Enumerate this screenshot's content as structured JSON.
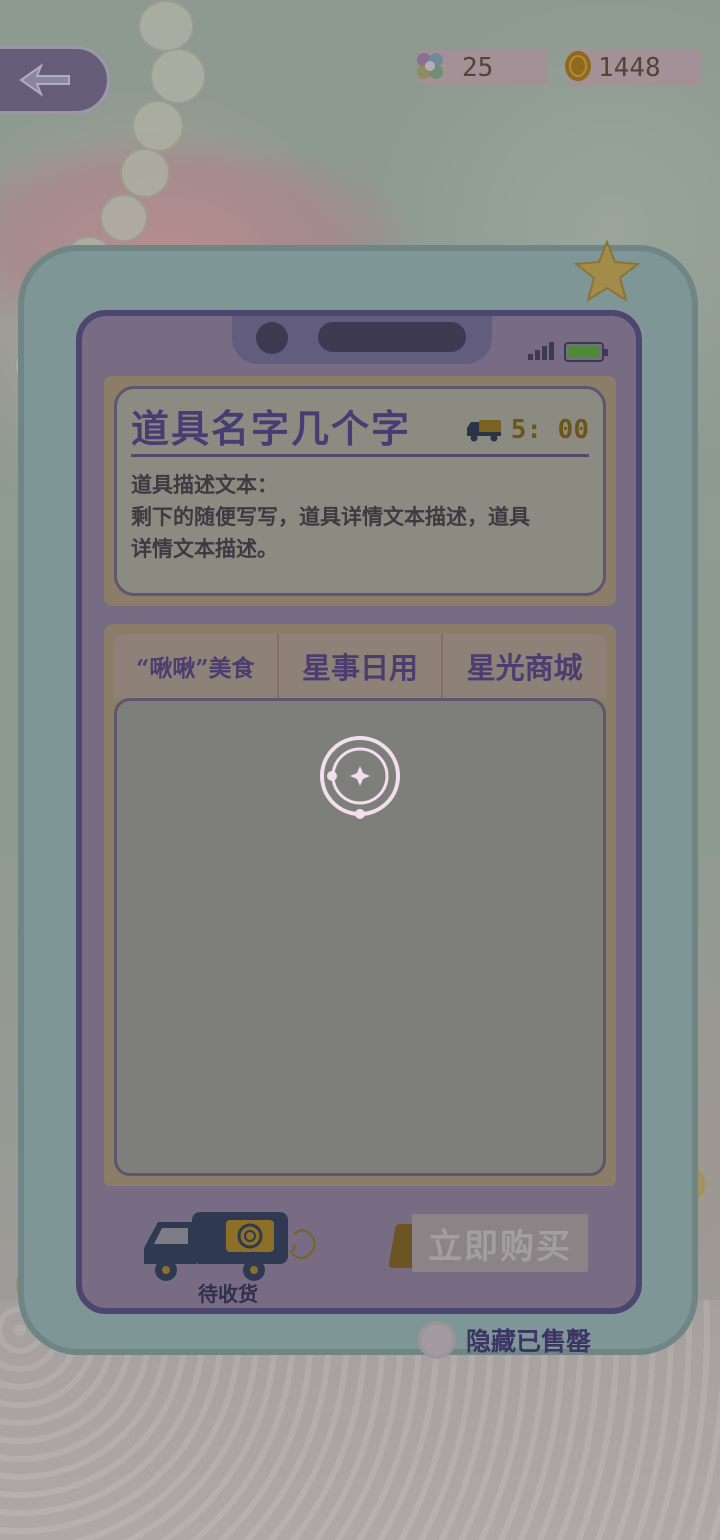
{
  "status": {
    "gems": "25",
    "coins": "1448",
    "gem_icon": "gem-flower-icon",
    "coin_icon": "coin-icon"
  },
  "back_icon": "back-arrow-icon",
  "item": {
    "title": "道具名字几个字",
    "delivery_time": "5: 00",
    "description_line1": "道具描述文本：",
    "description_line2": "剩下的随便写写，道具详情文本描述，道具",
    "description_line3": "详情文本描述。"
  },
  "tabs": [
    {
      "label": "“啾啾”美食"
    },
    {
      "label": "星事日用"
    },
    {
      "label": "星光商城"
    }
  ],
  "bottom": {
    "pending_label": "待收货",
    "buy_label": "立即购买",
    "hide_sold_label": "隐藏已售罄"
  },
  "colors": {
    "title_purple": "#463d72",
    "timer_gold": "#6d5418",
    "battery_green": "#4f8a3a",
    "frame_navy": "#4d4670"
  }
}
